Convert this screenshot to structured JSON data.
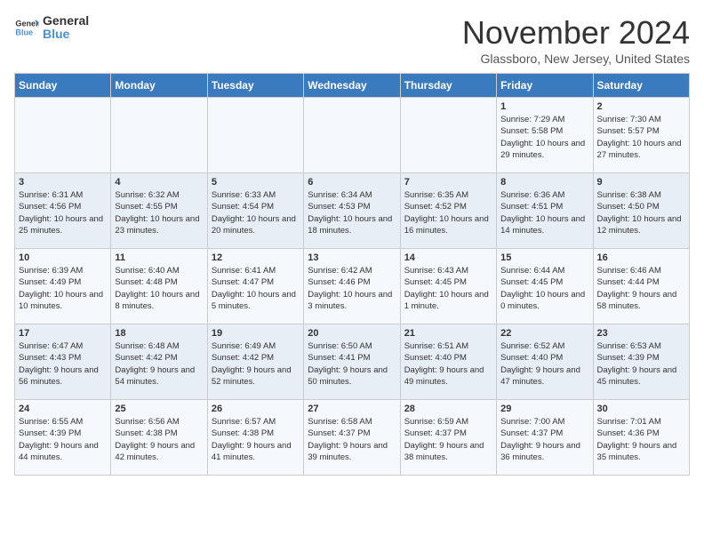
{
  "logo": {
    "line1": "General",
    "line2": "Blue"
  },
  "title": "November 2024",
  "location": "Glassboro, New Jersey, United States",
  "weekdays": [
    "Sunday",
    "Monday",
    "Tuesday",
    "Wednesday",
    "Thursday",
    "Friday",
    "Saturday"
  ],
  "weeks": [
    [
      {
        "day": "",
        "info": ""
      },
      {
        "day": "",
        "info": ""
      },
      {
        "day": "",
        "info": ""
      },
      {
        "day": "",
        "info": ""
      },
      {
        "day": "",
        "info": ""
      },
      {
        "day": "1",
        "info": "Sunrise: 7:29 AM\nSunset: 5:58 PM\nDaylight: 10 hours and 29 minutes."
      },
      {
        "day": "2",
        "info": "Sunrise: 7:30 AM\nSunset: 5:57 PM\nDaylight: 10 hours and 27 minutes."
      }
    ],
    [
      {
        "day": "3",
        "info": "Sunrise: 6:31 AM\nSunset: 4:56 PM\nDaylight: 10 hours and 25 minutes."
      },
      {
        "day": "4",
        "info": "Sunrise: 6:32 AM\nSunset: 4:55 PM\nDaylight: 10 hours and 23 minutes."
      },
      {
        "day": "5",
        "info": "Sunrise: 6:33 AM\nSunset: 4:54 PM\nDaylight: 10 hours and 20 minutes."
      },
      {
        "day": "6",
        "info": "Sunrise: 6:34 AM\nSunset: 4:53 PM\nDaylight: 10 hours and 18 minutes."
      },
      {
        "day": "7",
        "info": "Sunrise: 6:35 AM\nSunset: 4:52 PM\nDaylight: 10 hours and 16 minutes."
      },
      {
        "day": "8",
        "info": "Sunrise: 6:36 AM\nSunset: 4:51 PM\nDaylight: 10 hours and 14 minutes."
      },
      {
        "day": "9",
        "info": "Sunrise: 6:38 AM\nSunset: 4:50 PM\nDaylight: 10 hours and 12 minutes."
      }
    ],
    [
      {
        "day": "10",
        "info": "Sunrise: 6:39 AM\nSunset: 4:49 PM\nDaylight: 10 hours and 10 minutes."
      },
      {
        "day": "11",
        "info": "Sunrise: 6:40 AM\nSunset: 4:48 PM\nDaylight: 10 hours and 8 minutes."
      },
      {
        "day": "12",
        "info": "Sunrise: 6:41 AM\nSunset: 4:47 PM\nDaylight: 10 hours and 5 minutes."
      },
      {
        "day": "13",
        "info": "Sunrise: 6:42 AM\nSunset: 4:46 PM\nDaylight: 10 hours and 3 minutes."
      },
      {
        "day": "14",
        "info": "Sunrise: 6:43 AM\nSunset: 4:45 PM\nDaylight: 10 hours and 1 minute."
      },
      {
        "day": "15",
        "info": "Sunrise: 6:44 AM\nSunset: 4:45 PM\nDaylight: 10 hours and 0 minutes."
      },
      {
        "day": "16",
        "info": "Sunrise: 6:46 AM\nSunset: 4:44 PM\nDaylight: 9 hours and 58 minutes."
      }
    ],
    [
      {
        "day": "17",
        "info": "Sunrise: 6:47 AM\nSunset: 4:43 PM\nDaylight: 9 hours and 56 minutes."
      },
      {
        "day": "18",
        "info": "Sunrise: 6:48 AM\nSunset: 4:42 PM\nDaylight: 9 hours and 54 minutes."
      },
      {
        "day": "19",
        "info": "Sunrise: 6:49 AM\nSunset: 4:42 PM\nDaylight: 9 hours and 52 minutes."
      },
      {
        "day": "20",
        "info": "Sunrise: 6:50 AM\nSunset: 4:41 PM\nDaylight: 9 hours and 50 minutes."
      },
      {
        "day": "21",
        "info": "Sunrise: 6:51 AM\nSunset: 4:40 PM\nDaylight: 9 hours and 49 minutes."
      },
      {
        "day": "22",
        "info": "Sunrise: 6:52 AM\nSunset: 4:40 PM\nDaylight: 9 hours and 47 minutes."
      },
      {
        "day": "23",
        "info": "Sunrise: 6:53 AM\nSunset: 4:39 PM\nDaylight: 9 hours and 45 minutes."
      }
    ],
    [
      {
        "day": "24",
        "info": "Sunrise: 6:55 AM\nSunset: 4:39 PM\nDaylight: 9 hours and 44 minutes."
      },
      {
        "day": "25",
        "info": "Sunrise: 6:56 AM\nSunset: 4:38 PM\nDaylight: 9 hours and 42 minutes."
      },
      {
        "day": "26",
        "info": "Sunrise: 6:57 AM\nSunset: 4:38 PM\nDaylight: 9 hours and 41 minutes."
      },
      {
        "day": "27",
        "info": "Sunrise: 6:58 AM\nSunset: 4:37 PM\nDaylight: 9 hours and 39 minutes."
      },
      {
        "day": "28",
        "info": "Sunrise: 6:59 AM\nSunset: 4:37 PM\nDaylight: 9 hours and 38 minutes."
      },
      {
        "day": "29",
        "info": "Sunrise: 7:00 AM\nSunset: 4:37 PM\nDaylight: 9 hours and 36 minutes."
      },
      {
        "day": "30",
        "info": "Sunrise: 7:01 AM\nSunset: 4:36 PM\nDaylight: 9 hours and 35 minutes."
      }
    ]
  ]
}
